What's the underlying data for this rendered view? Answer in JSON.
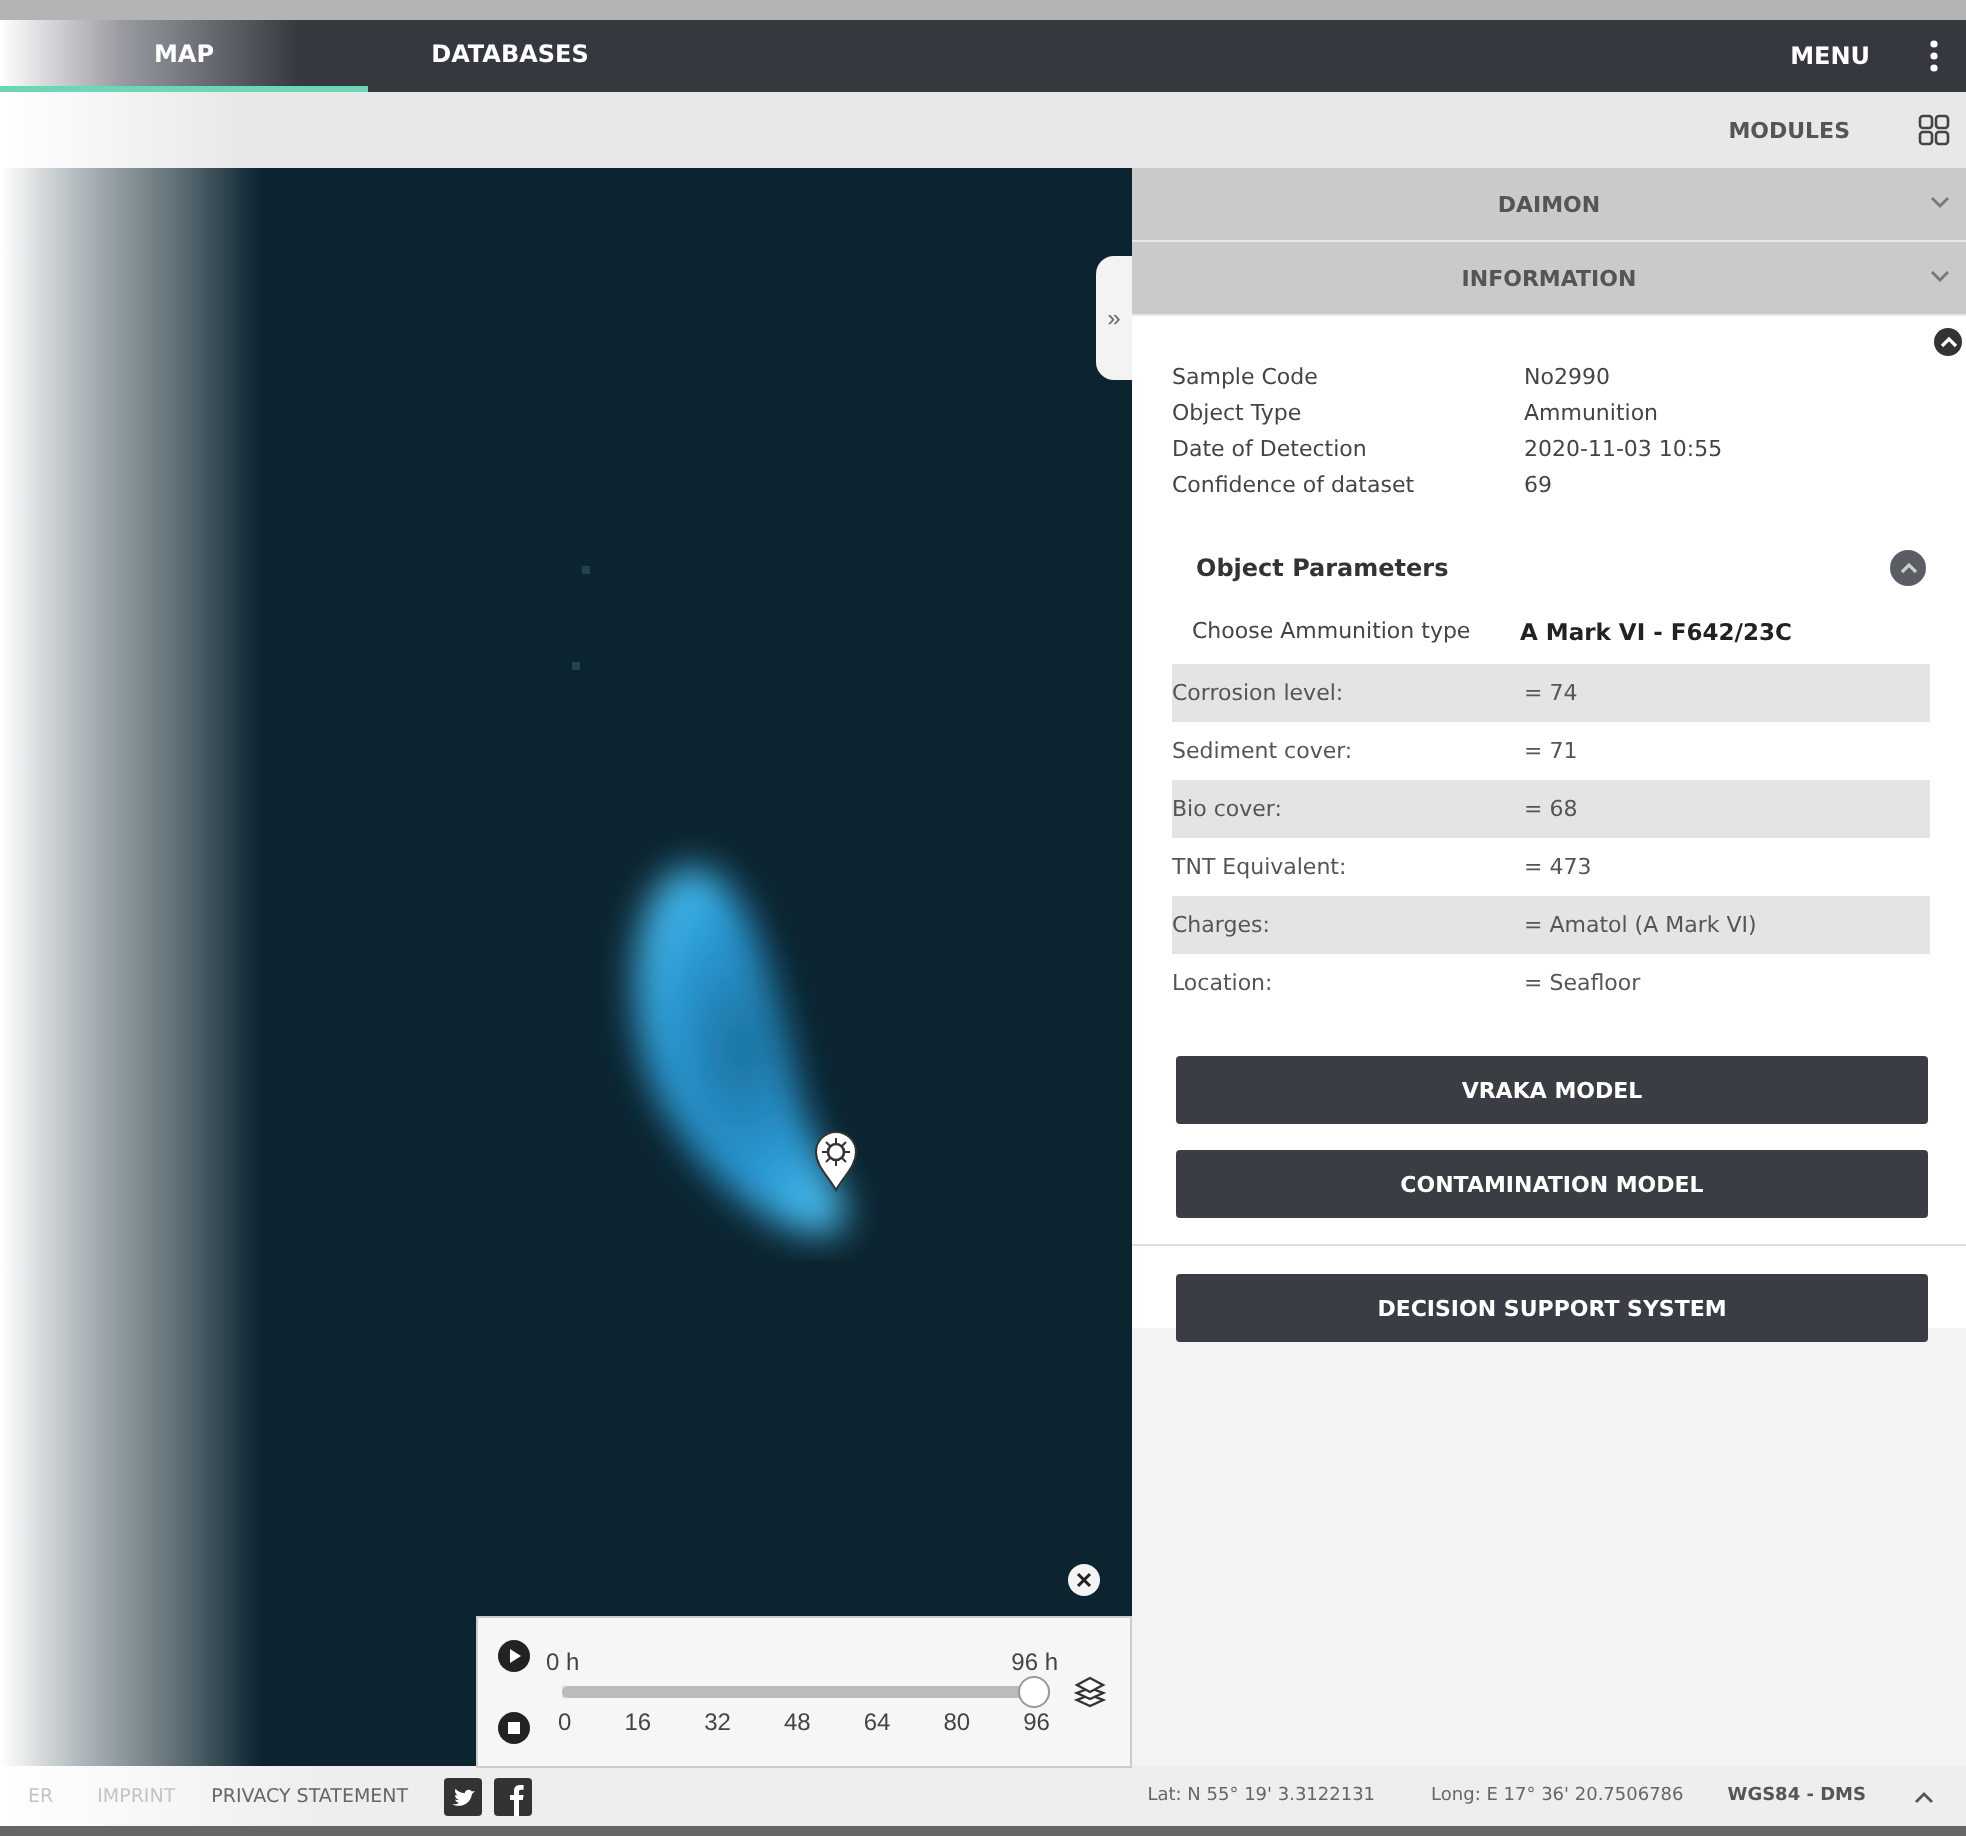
{
  "nav": {
    "tabs": [
      {
        "label": "MAP",
        "selected": true
      },
      {
        "label": "DATABASES",
        "selected": false
      }
    ],
    "menu": "MENU"
  },
  "subbar": {
    "modules": "MODULES"
  },
  "map": {
    "handle": "»"
  },
  "panel": {
    "sections": [
      {
        "title": "DAIMON",
        "expanded": false
      },
      {
        "title": "INFORMATION",
        "expanded": false
      }
    ],
    "info": [
      {
        "label": "Sample Code",
        "value": "No2990"
      },
      {
        "label": "Object Type",
        "value": "Ammunition"
      },
      {
        "label": "Date of Detection",
        "value": "2020-11-03 10:55"
      },
      {
        "label": "Confidence of dataset",
        "value": "69"
      }
    ],
    "parameters_title": "Object Parameters",
    "ammunition": {
      "label": "Choose Ammunition type",
      "value": "A Mark VI - F642/23C"
    },
    "parameters": [
      {
        "label": "Corrosion level:",
        "value": "= 74"
      },
      {
        "label": "Sediment cover:",
        "value": "= 71"
      },
      {
        "label": "Bio cover:",
        "value": "= 68"
      },
      {
        "label": "TNT Equivalent:",
        "value": "= 473"
      },
      {
        "label": "Charges:",
        "value": "= Amatol (A Mark VI)"
      },
      {
        "label": "Location:",
        "value": "= Seafloor"
      }
    ],
    "model_buttons": [
      "VRAKA MODEL",
      "CONTAMINATION MODEL"
    ],
    "decision_button": "DECISION SUPPORT SYSTEM"
  },
  "timeline": {
    "start": "0 h",
    "end": "96 h",
    "level": 1,
    "ticks": [
      "0",
      "16",
      "32",
      "48",
      "64",
      "80",
      "96"
    ]
  },
  "footer": {
    "links": [
      "ER",
      "IMPRINT",
      "PRIVACY STATEMENT"
    ],
    "lat": "Lat: N 55° 19' 3.3122131",
    "long": "Long: E 17° 36' 20.7506786",
    "projection": "WGS84 - DMS"
  }
}
